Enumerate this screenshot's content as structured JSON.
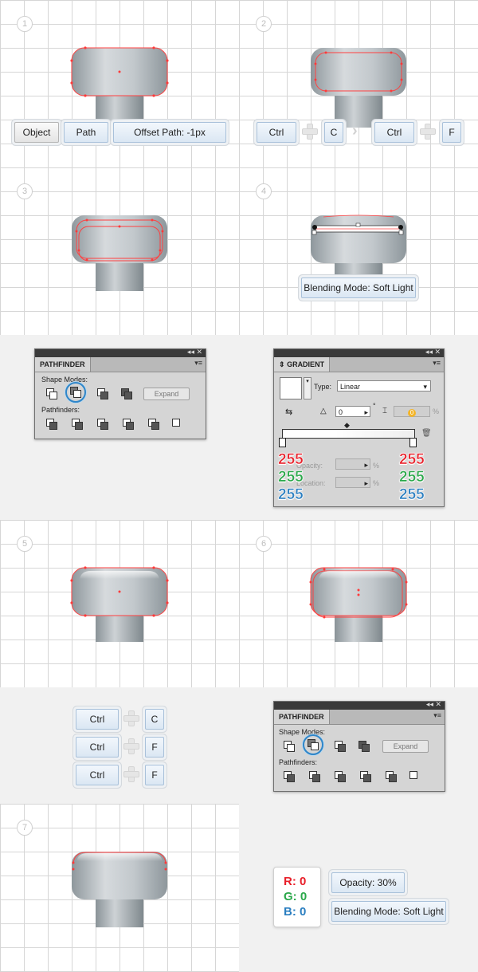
{
  "steps": [
    "1",
    "2",
    "3",
    "4",
    "5",
    "6",
    "7"
  ],
  "step1": {
    "path_buttons": [
      "Object",
      "Path",
      "Offset Path: -1px"
    ]
  },
  "step2": {
    "shortcut": [
      "Ctrl",
      "C",
      "Ctrl",
      "F"
    ]
  },
  "step4": {
    "note": "Blending Mode: Soft Light"
  },
  "pathfinder": {
    "title": "PATHFINDER",
    "shape_modes": "Shape Modes:",
    "expand": "Expand",
    "pathfinders": "Pathfinders:",
    "selected_mode": "minus-front"
  },
  "gradient": {
    "title": "GRADIENT",
    "type_label": "Type:",
    "type_value": "Linear",
    "angle": "0",
    "angle_unit": "°",
    "aspect": "0",
    "aspect_unit": "%",
    "opacity_label": "Opacity:",
    "location_label": "Location:",
    "pct": "%",
    "left_stop": {
      "r": "255",
      "g": "255",
      "b": "255"
    },
    "right_stop": {
      "r": "255",
      "g": "255",
      "b": "255"
    }
  },
  "step6_shortcuts": [
    [
      "Ctrl",
      "C"
    ],
    [
      "Ctrl",
      "F"
    ],
    [
      "Ctrl",
      "F"
    ]
  ],
  "step7": {
    "rgb": {
      "r": "R: 0",
      "g": "G: 0",
      "b": "B: 0"
    },
    "opacity": "Opacity: 30%",
    "blend": "Blending Mode: Soft Light"
  },
  "colors": {
    "red": "#e8202a",
    "green": "#2aa84a",
    "blue": "#2a7ec0",
    "anchor": "#ff3b3b",
    "metal_light": "#d6dadd",
    "metal_dark": "#8e979c"
  }
}
